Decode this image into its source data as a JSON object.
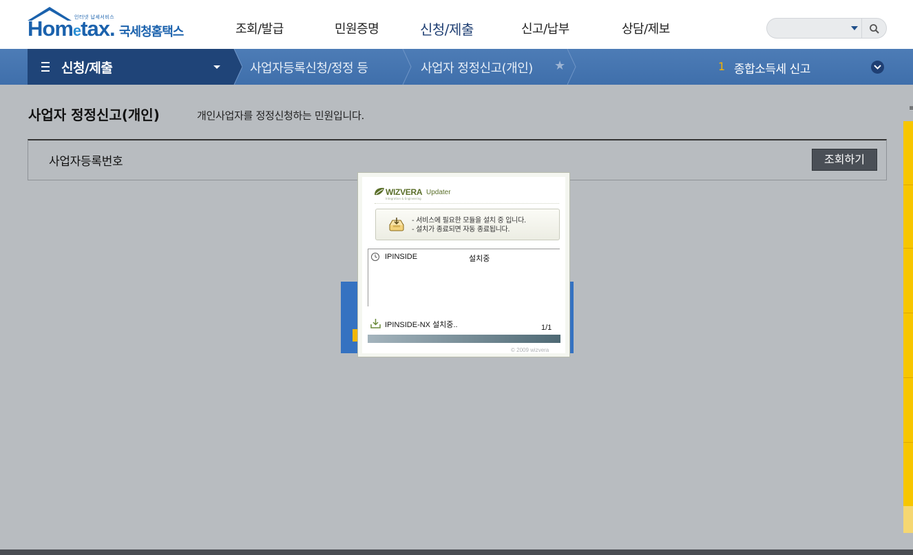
{
  "header": {
    "logo_small": "인터넷 납세서비스",
    "logo_main_1": "Hom",
    "logo_main_e": "e",
    "logo_main_2": "tax.",
    "logo_kr": "국세청홈택스",
    "gnb": [
      {
        "label": "조회/발급"
      },
      {
        "label": "민원증명"
      },
      {
        "label": "신청/제출",
        "active": true
      },
      {
        "label": "신고/납부"
      },
      {
        "label": "상담/제보"
      }
    ],
    "search": {
      "placeholder": ""
    }
  },
  "navbar": {
    "menu_label": "신청/제출",
    "crumbs": [
      "사업자등록신청/정정 등",
      "사업자 정정신고(개인)"
    ],
    "right_num": "1",
    "right_text": "종합소득세 신고"
  },
  "main": {
    "title": "사업자 정정신고(개인)",
    "description": "개인사업자를 정정신청하는 민원입니다.",
    "form_label": "사업자등록번호",
    "lookup_button": "조회하기"
  },
  "updater": {
    "brand": "WIZVERA",
    "title": "Updater",
    "subtitle": "Integration & Engineering",
    "notice_line1": "- 서비스에 필요한 모듈을 설치 중 입니다.",
    "notice_line2": "- 설치가 종료되면 자동 종료됩니다.",
    "items": [
      {
        "name": "IPINSIDE",
        "status": "설치중"
      }
    ],
    "download_text": "IPINSIDE-NX 설치중..",
    "count": "1/1",
    "progress": 1.0,
    "copyright": "© 2009  wizvera"
  },
  "colors": {
    "nav_blue": "#4d7cb6",
    "nav_dark": "#1f4478",
    "accent_yellow": "#f7c600"
  }
}
